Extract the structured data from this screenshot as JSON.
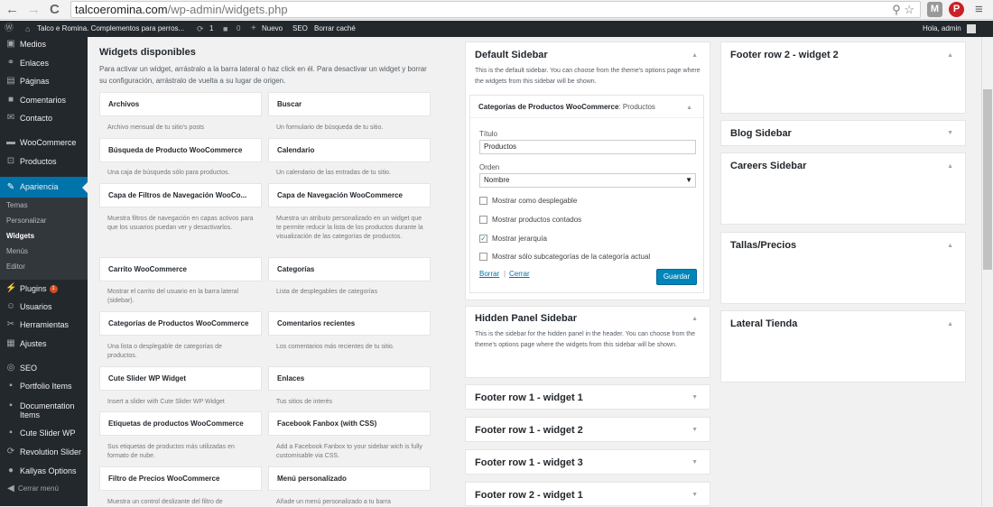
{
  "browser": {
    "back": "←",
    "forward": "→",
    "reload": "C",
    "url_host": "talcoeromina.com",
    "url_path": "/wp-admin/widgets.php",
    "ext_m": "M",
    "ext_p": "P",
    "menu": "≡"
  },
  "adminbar": {
    "site_name": "Talco e Romina. Complementos para perros...",
    "updates": "1",
    "comments": "0",
    "new": "Nuevo",
    "seo": "SEO",
    "cache": "Borrar caché",
    "greeting": "Hola, admin"
  },
  "sidebar": {
    "items": [
      {
        "label": "Medios",
        "icon": "media-icon"
      },
      {
        "label": "Enlaces",
        "icon": "links-icon"
      },
      {
        "label": "Páginas",
        "icon": "pages-icon"
      },
      {
        "label": "Comentarios",
        "icon": "comments-icon"
      },
      {
        "label": "Contacto",
        "icon": "mail-icon"
      },
      {
        "label": "WooCommerce",
        "icon": "woocommerce-icon"
      },
      {
        "label": "Productos",
        "icon": "products-icon"
      },
      {
        "label": "Apariencia",
        "icon": "appearance-icon"
      },
      {
        "label": "Plugins",
        "icon": "plugins-icon",
        "badge": "1"
      },
      {
        "label": "Usuarios",
        "icon": "users-icon"
      },
      {
        "label": "Herramientas",
        "icon": "tools-icon"
      },
      {
        "label": "Ajustes",
        "icon": "settings-icon"
      },
      {
        "label": "SEO",
        "icon": "seo-icon"
      },
      {
        "label": "Portfolio Items",
        "icon": "portfolio-icon"
      },
      {
        "label": "Documentation",
        "label2": "Items",
        "icon": "documentation-icon"
      },
      {
        "label": "Cute Slider WP",
        "icon": "slider-icon"
      },
      {
        "label": "Revolution Slider",
        "icon": "revolution-icon"
      },
      {
        "label": "Kallyas Options",
        "icon": "options-icon"
      },
      {
        "label": "Cerrar menú",
        "icon": "collapse-icon"
      }
    ],
    "submenu": [
      "Temas",
      "Personalizar",
      "Widgets",
      "Menús",
      "Editor"
    ]
  },
  "available": {
    "title": "Widgets disponibles",
    "description": "Para activar un widget, arrástralo a la barra lateral o haz click en él. Para desactivar un widget y borrar su configuración, arrástralo de vuelta a su lugar de origen.",
    "widgets": [
      {
        "name": "Archivos",
        "desc": "Archivo mensual de tu sitio's posts"
      },
      {
        "name": "Buscar",
        "desc": "Un formulario de búsqueda de tu sitio."
      },
      {
        "name": "Búsqueda de Producto WooCommerce",
        "desc": "Una caja de búsqueda sólo para productos."
      },
      {
        "name": "Calendario",
        "desc": "Un calendario de las entradas de tu sitio."
      },
      {
        "name": "Capa de Filtros de Navegación WooCo...",
        "desc": "Muestra filtros de navegación en capas activos para que los usuarios puedan ver y desactivarlos."
      },
      {
        "name": "Capa de Navegación WooCommerce",
        "desc": "Muestra un atributo personalizado en un widget que te permite reducir la lista de los productos durante la visualización de las categorías de productos."
      },
      {
        "name": "Carrito WooCommerce",
        "desc": "Mostrar el carrito del usuario en la barra lateral (sidebar)."
      },
      {
        "name": "Categorías",
        "desc": "Lista de desplegables de categorías"
      },
      {
        "name": "Categorías de Productos WooCommerce",
        "desc": "Una lista o desplegable de categorías de productos."
      },
      {
        "name": "Comentarios recientes",
        "desc": "Los comentarios más recientes de tu sitio."
      },
      {
        "name": "Cute Slider WP Widget",
        "desc": "Insert a slider with Cute Slider WP Widget"
      },
      {
        "name": "Enlaces",
        "desc": "Tus sitios de interés"
      },
      {
        "name": "Etiquetas de productos WooCommerce",
        "desc": "Sus etiquetas de productos más utilizadas en formato de nube."
      },
      {
        "name": "Facebook Fanbox (with CSS)",
        "desc": "Add a Facebook Fanbox to your sidebar wich is fully customisable via CSS."
      },
      {
        "name": "Filtro de Precios WooCommerce",
        "desc": "Muestra un control deslizante del filtro de"
      },
      {
        "name": "Menú personalizado",
        "desc": "Añade un menú personalizado a tu barra"
      }
    ]
  },
  "default_sidebar": {
    "title": "Default Sidebar",
    "description": "This is the default sidebar. You can choose from the theme's options page where the widgets from this sidebar will be shown.",
    "widget": {
      "head": "Categorías de Productos WooCommerce",
      "head_suffix": ": Productos",
      "title_label": "Título",
      "title_value": "Productos",
      "order_label": "Orden",
      "order_value": "Nombre",
      "checkboxes": [
        {
          "label": "Mostrar como desplegable",
          "checked": false
        },
        {
          "label": "Mostrar productos contados",
          "checked": false
        },
        {
          "label": "Mostrar jerarquía",
          "checked": true
        },
        {
          "label": "Mostrar sólo subcategorías de la categoría actual",
          "checked": false
        }
      ],
      "delete": "Borrar",
      "sep": "|",
      "close": "Cerrar",
      "save": "Guardar"
    }
  },
  "hidden_panel": {
    "title": "Hidden Panel Sidebar",
    "description": "This is the sidebar for the hidden panel in the header. You can choose from the theme's options page where the widgets from this sidebar will be shown."
  },
  "footer_sidebars": [
    "Footer row 1 - widget 1",
    "Footer row 1 - widget 2",
    "Footer row 1 - widget 3",
    "Footer row 2 - widget 1"
  ],
  "right_sidebars": [
    "Footer row 2 - widget 2",
    "Blog Sidebar",
    "Careers Sidebar",
    "Tallas/Precios",
    "Lateral Tienda"
  ],
  "icons": {
    "up": "▲",
    "down": "▼",
    "star": "☆",
    "search": "⚲",
    "check": "✓",
    "select_arrow": "▼"
  }
}
